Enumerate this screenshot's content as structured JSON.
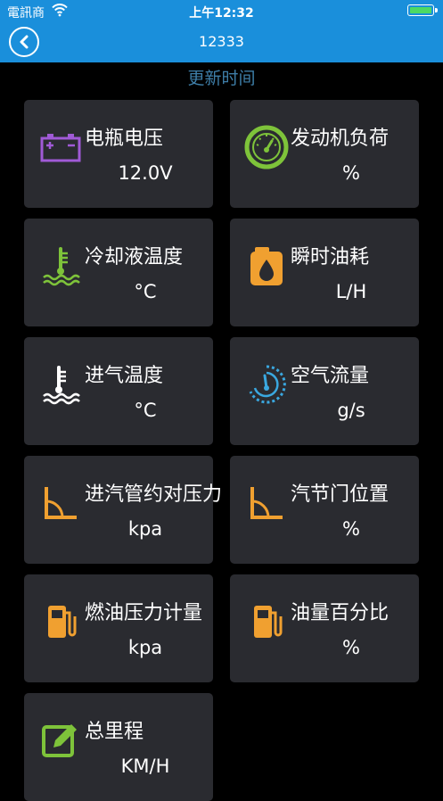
{
  "status_bar": {
    "carrier": "電訊商",
    "time": "上午12:32"
  },
  "nav": {
    "title": "12333"
  },
  "update_label": "更新时间",
  "cards": [
    {
      "id": "battery-voltage",
      "label": "电瓶电压",
      "value": "12.0V",
      "icon": "battery-icon",
      "icon_color": "#a05ad6"
    },
    {
      "id": "engine-load",
      "label": "发动机负荷",
      "value": "%",
      "icon": "speedometer-icon",
      "icon_color": "#7ec33a"
    },
    {
      "id": "coolant-temp",
      "label": "冷却液温度",
      "value": "°C",
      "icon": "coolant-thermometer-icon",
      "icon_color": "#7ec33a"
    },
    {
      "id": "instant-fuel",
      "label": "瞬时油耗",
      "value": "L/H",
      "icon": "fuel-can-icon",
      "icon_color": "#f0a030"
    },
    {
      "id": "intake-temp",
      "label": "进气温度",
      "value": "°C",
      "icon": "intake-thermometer-icon",
      "icon_color": "#ffffff"
    },
    {
      "id": "air-flow",
      "label": "空气流量",
      "value": "g/s",
      "icon": "air-flow-gauge-icon",
      "icon_color": "#3aa8e0"
    },
    {
      "id": "intake-pressure",
      "label": "进汽管约对压力",
      "value": "kpa",
      "icon": "pressure-angle-icon",
      "icon_color": "#f0a030"
    },
    {
      "id": "throttle-position",
      "label": "汽节门位置",
      "value": "%",
      "icon": "throttle-angle-icon",
      "icon_color": "#f0a030"
    },
    {
      "id": "fuel-pressure",
      "label": "燃油压力计量",
      "value": "kpa",
      "icon": "fuel-pump-icon",
      "icon_color": "#f0a030"
    },
    {
      "id": "fuel-level",
      "label": "油量百分比",
      "value": "%",
      "icon": "fuel-pump-icon",
      "icon_color": "#f0a030"
    },
    {
      "id": "total-mileage",
      "label": "总里程",
      "value": "KM/H",
      "icon": "edit-note-icon",
      "icon_color": "#7ec33a"
    }
  ]
}
